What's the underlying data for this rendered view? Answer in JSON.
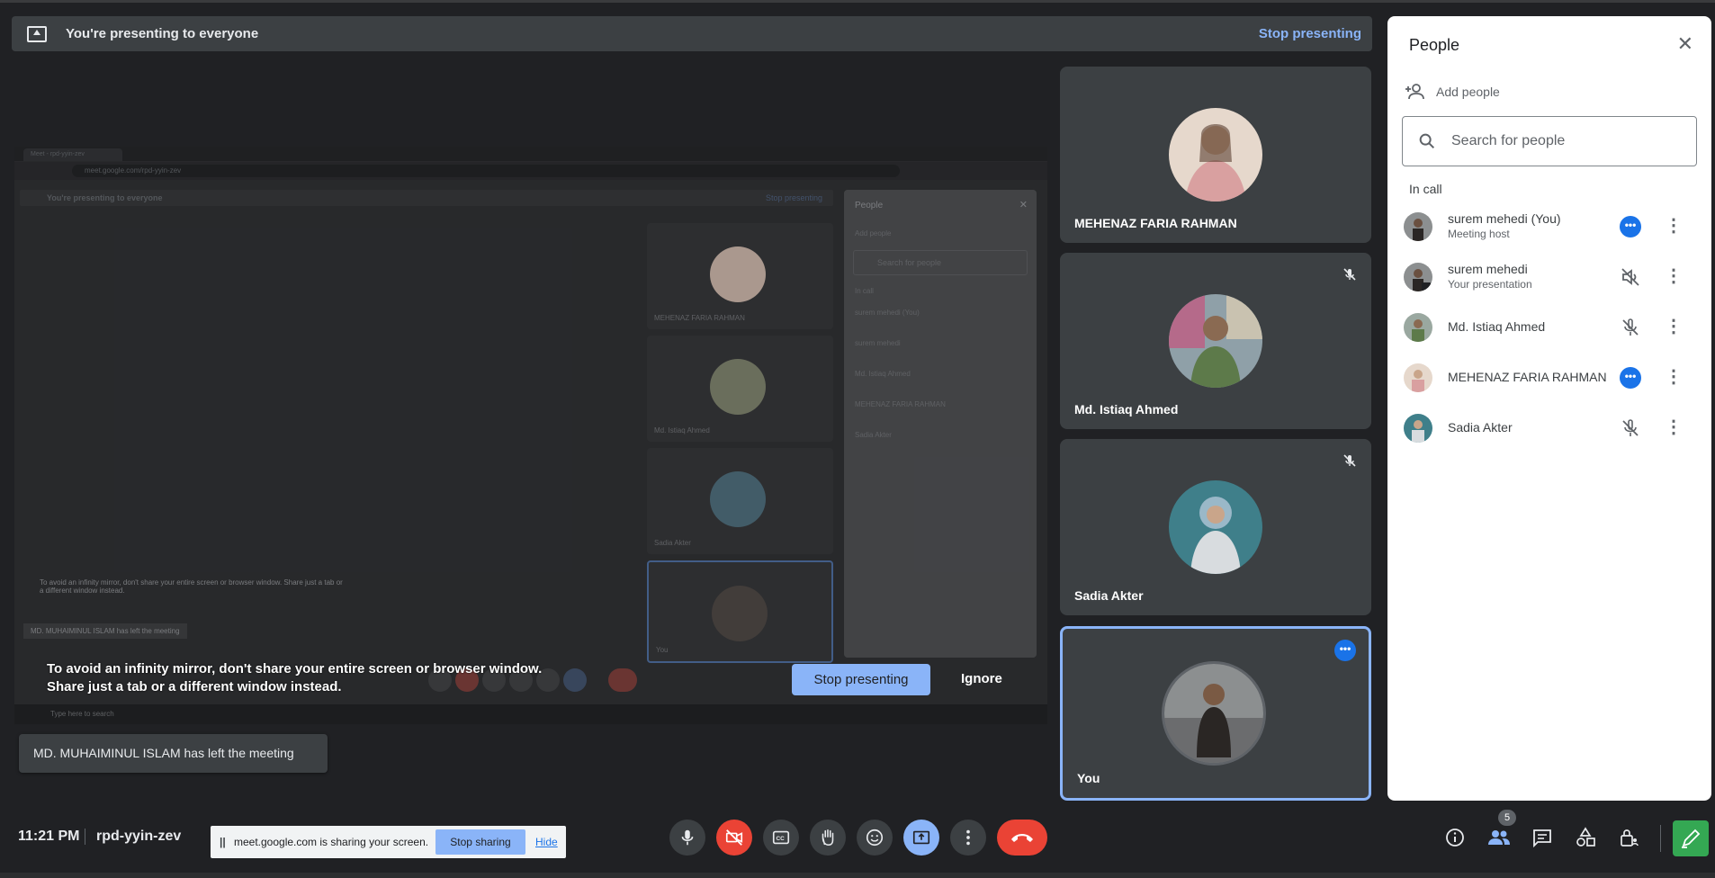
{
  "banner": {
    "text": "You're presenting to everyone",
    "stop": "Stop presenting"
  },
  "shared_screen": {
    "tab_title": "Meet - rpd-yyin-zev",
    "url": "meet.google.com/rpd-yyin-zev",
    "banner_text": "You're presenting to everyone",
    "banner_stop": "Stop presenting",
    "tiles": [
      "MEHENAZ FARIA RAHMAN",
      "Md. Istiaq Ahmed",
      "Sadia Akter",
      "You"
    ],
    "panel_title": "People",
    "panel_add": "Add people",
    "panel_search": "Search for people",
    "panel_incall": "In call",
    "panel_rows": [
      "surem mehedi (You)",
      "surem mehedi",
      "Md. Istiaq Ahmed",
      "MEHENAZ FARIA RAHMAN",
      "Sadia Akter"
    ],
    "warning": "To avoid an infinity mirror, don't share your entire screen or browser window. Share just a tab or a different window instead.",
    "toast": "MD. MUHAIMINUL ISLAM has left the meeting",
    "taskbar_search": "Type here to search"
  },
  "warning": {
    "text": "To avoid an infinity mirror, don't share your entire screen or browser window. Share just a tab or a different window instead.",
    "stop": "Stop presenting",
    "ignore": "Ignore"
  },
  "toast": "MD. MUHAIMINUL ISLAM has left the meeting",
  "tiles": [
    {
      "name": "MEHENAZ FARIA RAHMAN",
      "muted": false
    },
    {
      "name": "Md. Istiaq Ahmed",
      "muted": true
    },
    {
      "name": "Sadia Akter",
      "muted": true
    },
    {
      "name": "You",
      "speaking": true
    }
  ],
  "people_panel": {
    "title": "People",
    "add_people": "Add people",
    "search_placeholder": "Search for people",
    "in_call": "In call",
    "people": [
      {
        "name": "surem mehedi (You)",
        "sub": "Meeting host",
        "status": "more-dots"
      },
      {
        "name": "surem mehedi",
        "sub": "Your presentation",
        "status": "volume-off"
      },
      {
        "name": "Md. Istiaq Ahmed",
        "sub": "",
        "status": "mic-off"
      },
      {
        "name": "MEHENAZ FARIA RAHMAN",
        "sub": "",
        "status": "more-dots"
      },
      {
        "name": "Sadia Akter",
        "sub": "",
        "status": "mic-off"
      }
    ]
  },
  "bottom": {
    "time": "11:21 PM",
    "meeting_code": "rpd-yyin-zev",
    "share_message": "meet.google.com is sharing your screen.",
    "stop_sharing": "Stop sharing",
    "hide": "Hide",
    "people_count": "5"
  },
  "colors": {
    "accent": "#8ab4f8",
    "danger": "#ea4335",
    "host_blue": "#1a73e8",
    "companion": "#34a853"
  }
}
